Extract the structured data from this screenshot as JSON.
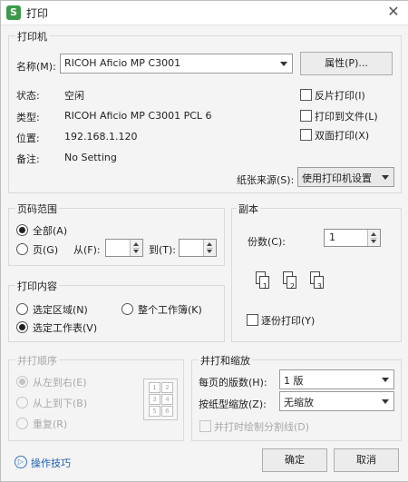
{
  "window": {
    "title": "打印",
    "app_icon": "S"
  },
  "printer": {
    "group_title": "打印机",
    "name_label": "名称(M):",
    "name_value": "RICOH Aficio MP C3001",
    "properties_button": "属性(P)...",
    "status_label": "状态:",
    "status_value": "空闲",
    "type_label": "类型:",
    "type_value": "RICOH Aficio MP C3001 PCL 6",
    "where_label": "位置:",
    "where_value": "192.168.1.120",
    "comment_label": "备注:",
    "comment_value": "No Setting",
    "reverse_print": "反片打印(I)",
    "print_to_file": "打印到文件(L)",
    "duplex": "双面打印(X)",
    "paper_source_label": "纸张来源(S):",
    "paper_source_value": "使用打印机设置"
  },
  "page_range": {
    "group_title": "页码范围",
    "all": "全部(A)",
    "pages": "页(G)",
    "from_label": "从(F):",
    "to_label": "到(T):",
    "from_value": "",
    "to_value": ""
  },
  "copies": {
    "group_title": "副本",
    "copies_label": "份数(C):",
    "copies_value": "1",
    "collate": "逐份打印(Y)",
    "collate_pages": [
      "1",
      "2",
      "3"
    ]
  },
  "print_what": {
    "group_title": "打印内容",
    "selection": "选定区域(N)",
    "whole_workbook": "整个工作簿(K)",
    "active_sheets": "选定工作表(V)"
  },
  "order": {
    "group_title": "并打顺序",
    "left_to_right": "从左到右(E)",
    "top_to_bottom": "从上到下(B)",
    "repeat": "重复(R)",
    "grid_numbers": [
      "1",
      "2",
      "3",
      "4",
      "5",
      "6"
    ]
  },
  "zoom": {
    "group_title": "并打和缩放",
    "pages_per_sheet_label": "每页的版数(H):",
    "pages_per_sheet_value": "1 版",
    "scale_label": "按纸型缩放(Z):",
    "scale_value": "无缩放",
    "draw_borders": "并打时绘制分割线(D)"
  },
  "footer": {
    "tips_link": "操作技巧",
    "ok": "确定",
    "cancel": "取消"
  },
  "colors": {
    "app_icon": "#3d9a4a",
    "link": "#1a5fb4"
  }
}
